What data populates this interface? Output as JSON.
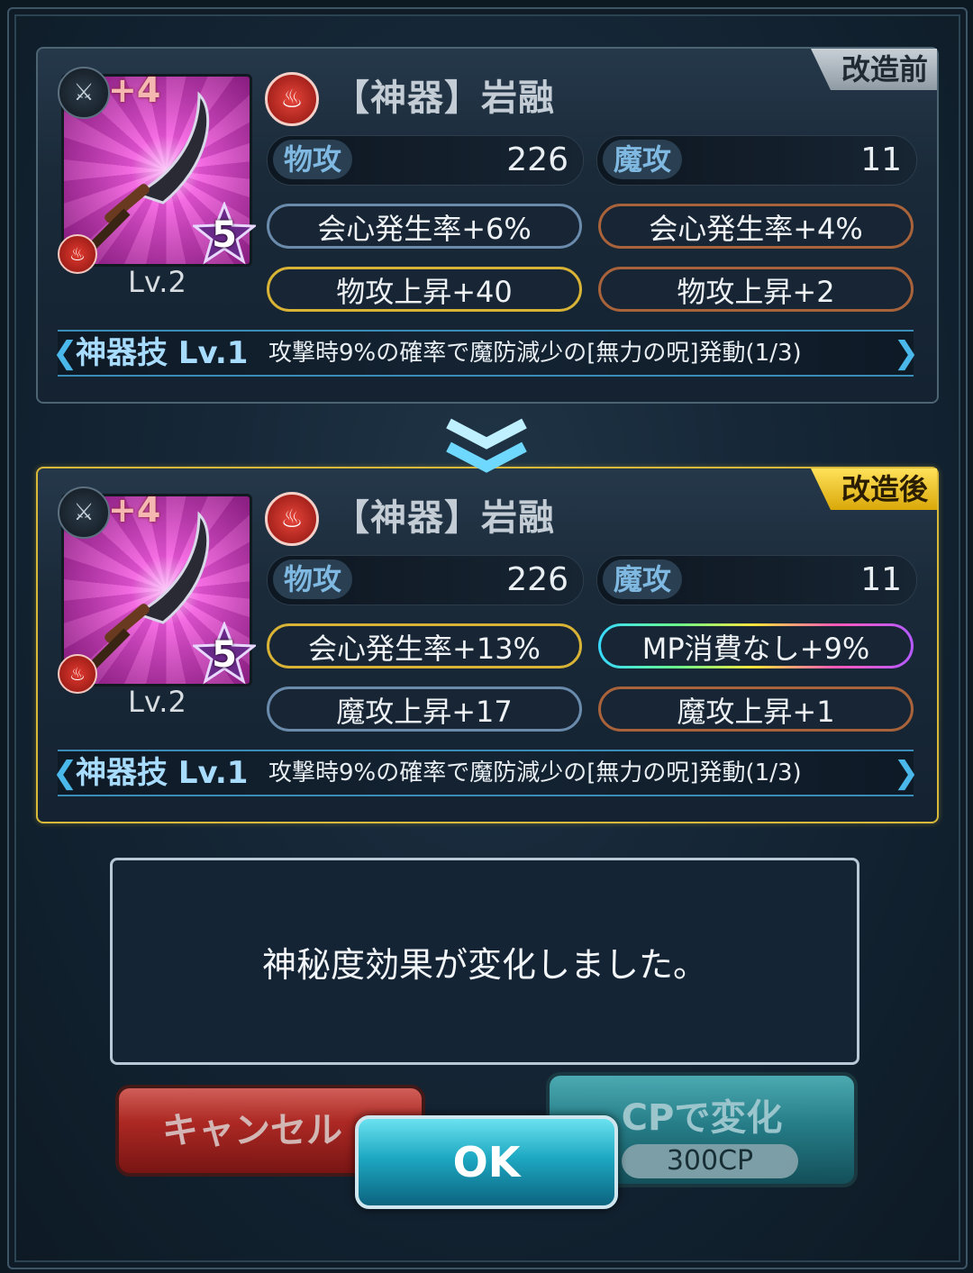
{
  "before": {
    "tag": "改造前",
    "item": {
      "plus": "+4",
      "rarity": "5",
      "level": "Lv.2",
      "name": "【神器】岩融"
    },
    "stats": {
      "phys_label": "物攻",
      "phys_value": "226",
      "mag_label": "魔攻",
      "mag_value": "11"
    },
    "effects": [
      {
        "text": "会心発生率+6%",
        "color": "blue"
      },
      {
        "text": "会心発生率+4%",
        "color": "bronze"
      },
      {
        "text": "物攻上昇+40",
        "color": "gold"
      },
      {
        "text": "物攻上昇+2",
        "color": "bronze"
      }
    ],
    "skill": {
      "name": "神器技 Lv.1",
      "desc": "攻撃時9%の確率で魔防減少の[無力の呪]発動(1/3)"
    }
  },
  "after": {
    "tag": "改造後",
    "item": {
      "plus": "+4",
      "rarity": "5",
      "level": "Lv.2",
      "name": "【神器】岩融"
    },
    "stats": {
      "phys_label": "物攻",
      "phys_value": "226",
      "mag_label": "魔攻",
      "mag_value": "11"
    },
    "effects": [
      {
        "text": "会心発生率+13%",
        "color": "gold"
      },
      {
        "text": "MP消費なし+9%",
        "color": "rainbow"
      },
      {
        "text": "魔攻上昇+17",
        "color": "blue"
      },
      {
        "text": "魔攻上昇+1",
        "color": "bronze"
      }
    ],
    "skill": {
      "name": "神器技 Lv.1",
      "desc": "攻撃時9%の確率で魔防減少の[無力の呪]発動(1/3)"
    }
  },
  "message": "神秘度効果が変化しました。",
  "buttons": {
    "cancel": "キャンセル",
    "cp_change": "CPで変化",
    "cp_cost": "300CP",
    "ok": "OK"
  },
  "colors": {
    "accent_gold": "#d9b93a",
    "ok_button": "#1ea8c2",
    "cancel_button": "#c82a22"
  }
}
